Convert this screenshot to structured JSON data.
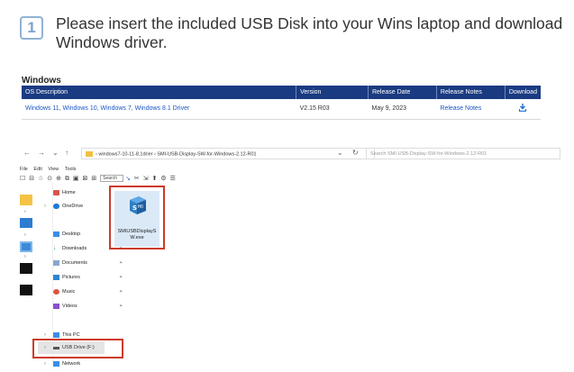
{
  "step": {
    "number": "1",
    "text": "Please insert the included USB Disk into your Wins laptop and download Windows driver."
  },
  "downloads": {
    "section_title": "Windows",
    "columns": [
      "OS Description",
      "Version",
      "Release Date",
      "Release Notes",
      "Download"
    ],
    "rows": [
      {
        "os": "Windows 11, Windows 10, Windows 7, Windows 8.1 Driver",
        "version": "V2.15 R03",
        "date": "May 9, 2023",
        "notes": "Release Notes",
        "download_icon": "download-icon"
      }
    ],
    "colors": {
      "header_bg": "#1a3b82",
      "link": "#1a56c4"
    }
  },
  "explorer": {
    "address": "›  windows7-10-11-8.1drier  ›  SMI-USB-Display-SW-for-Windows-2.12-R01",
    "search_placeholder": "Search SMI-USB-Display-SW-for-Windows-2.12-R01",
    "menu": [
      "File",
      "Edit",
      "View",
      "Tools"
    ],
    "toolbar_search": "Search",
    "nav": {
      "home": "Home",
      "onedrive": "OneDrive",
      "desktop": "Desktop",
      "downloads": "Downloads",
      "documents": "Documents",
      "pictures": "Pictures",
      "music": "Music",
      "videos": "Videos",
      "this_pc": "This PC",
      "usb_drive": "USB Drive (F:)",
      "network": "Network"
    },
    "file": {
      "name_line1": "SMIUSBDisplayS",
      "name_line2": "W.exe"
    },
    "highlight_color": "#cc3b2b"
  }
}
